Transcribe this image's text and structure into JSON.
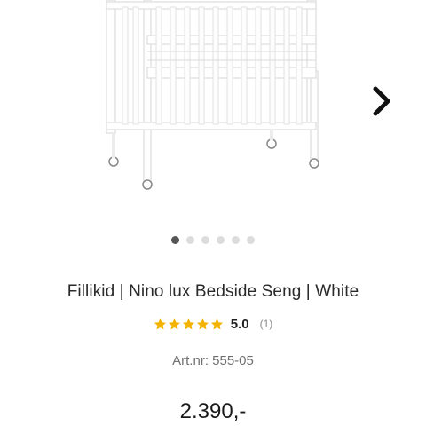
{
  "product": {
    "title": "Fillikid | Nino lux Bedside Seng | White",
    "rating_value": "5.0",
    "rating_count": "(1)",
    "rating_stars": 5,
    "article_number": "Art.nr: 555-05",
    "price": "2.390,-"
  },
  "gallery": {
    "image_count": 6,
    "active_index": 0,
    "next_icon": "chevron-right-icon",
    "image_icon": "bedside-crib-image"
  },
  "colors": {
    "star": "#f5b301",
    "dot_active": "#555555",
    "dot_inactive": "#dcdcdc",
    "arrow": "#111111"
  }
}
